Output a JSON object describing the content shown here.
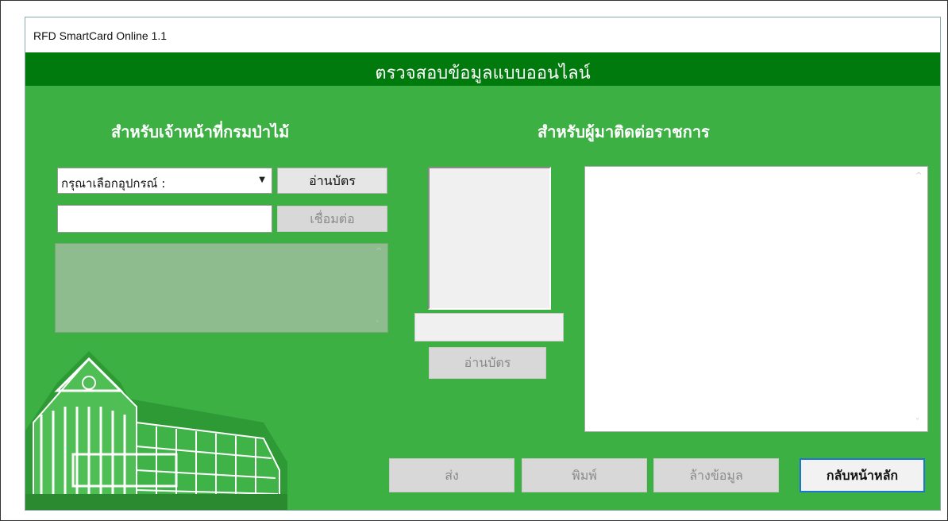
{
  "window": {
    "title": "RFD SmartCard Online 1.1"
  },
  "header": {
    "title": "ตรวจสอบข้อมูลแบบออนไลน์"
  },
  "left_panel": {
    "title": "สำหรับเจ้าหน้าที่กรมป่าไม้",
    "device_select": {
      "value": "กรุณาเลือกอุปกรณ์ :"
    },
    "read_card_label": "อ่านบัตร",
    "connect_label": "เชื่อมต่อ",
    "connect_input_value": "",
    "log_text": ""
  },
  "right_panel": {
    "title": "สำหรับผู้มาติดต่อราชการ",
    "name_value": "",
    "read_card_label": "อ่านบัตร",
    "info_text": ""
  },
  "bottom_bar": {
    "send_label": "ส่ง",
    "print_label": "พิมพ์",
    "clear_label": "ล้างข้อมูล",
    "home_label": "กลับหน้าหลัก"
  },
  "colors": {
    "panel_bg": "#3cb043",
    "header_bg": "#007a0c",
    "accent_border": "#1e74d6"
  },
  "icons": {
    "dropdown": "chevron-down-icon",
    "scroll_up": "scroll-up-icon",
    "scroll_down": "scroll-down-icon"
  }
}
